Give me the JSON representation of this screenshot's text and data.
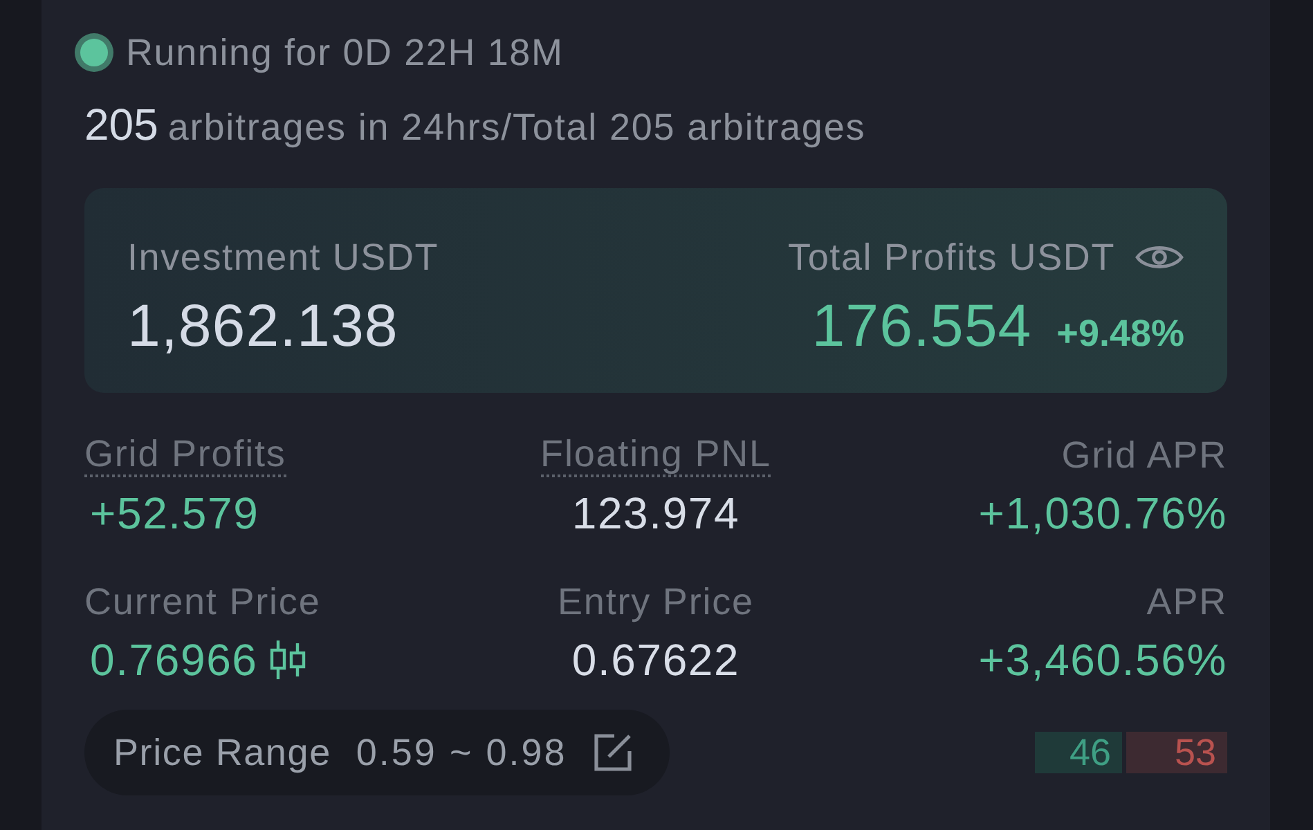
{
  "status": {
    "running": true,
    "label": "Running for 0D 22H 18M"
  },
  "arbitrage": {
    "count": "205",
    "text": "arbitrages in 24hrs/Total 205 arbitrages"
  },
  "summary": {
    "investment": {
      "label": "Investment USDT",
      "value": "1,862.138"
    },
    "profits": {
      "label": "Total Profits USDT",
      "value": "176.554",
      "change": "+9.48%"
    }
  },
  "metrics": [
    {
      "label": "Grid Profits",
      "value": "+52.579",
      "tooltip": true,
      "kind": "gain",
      "chart_icon": false
    },
    {
      "label": "Floating PNL",
      "value": "123.974",
      "tooltip": true,
      "kind": "plain",
      "chart_icon": false
    },
    {
      "label": "Grid APR",
      "value": "+1,030.76%",
      "tooltip": false,
      "kind": "gain",
      "chart_icon": false
    },
    {
      "label": "Current Price",
      "value": "0.76966",
      "tooltip": false,
      "kind": "gain",
      "chart_icon": true
    },
    {
      "label": "Entry Price",
      "value": "0.67622",
      "tooltip": false,
      "kind": "plain",
      "chart_icon": false
    },
    {
      "label": "APR",
      "value": "+3,460.56%",
      "tooltip": false,
      "kind": "gain",
      "chart_icon": false
    }
  ],
  "price_range": {
    "label": "Price Range",
    "value": "0.59 ~ 0.98"
  },
  "orders": [
    {
      "count": "46",
      "kind": "buy"
    },
    {
      "count": "53",
      "kind": "sell"
    }
  ]
}
